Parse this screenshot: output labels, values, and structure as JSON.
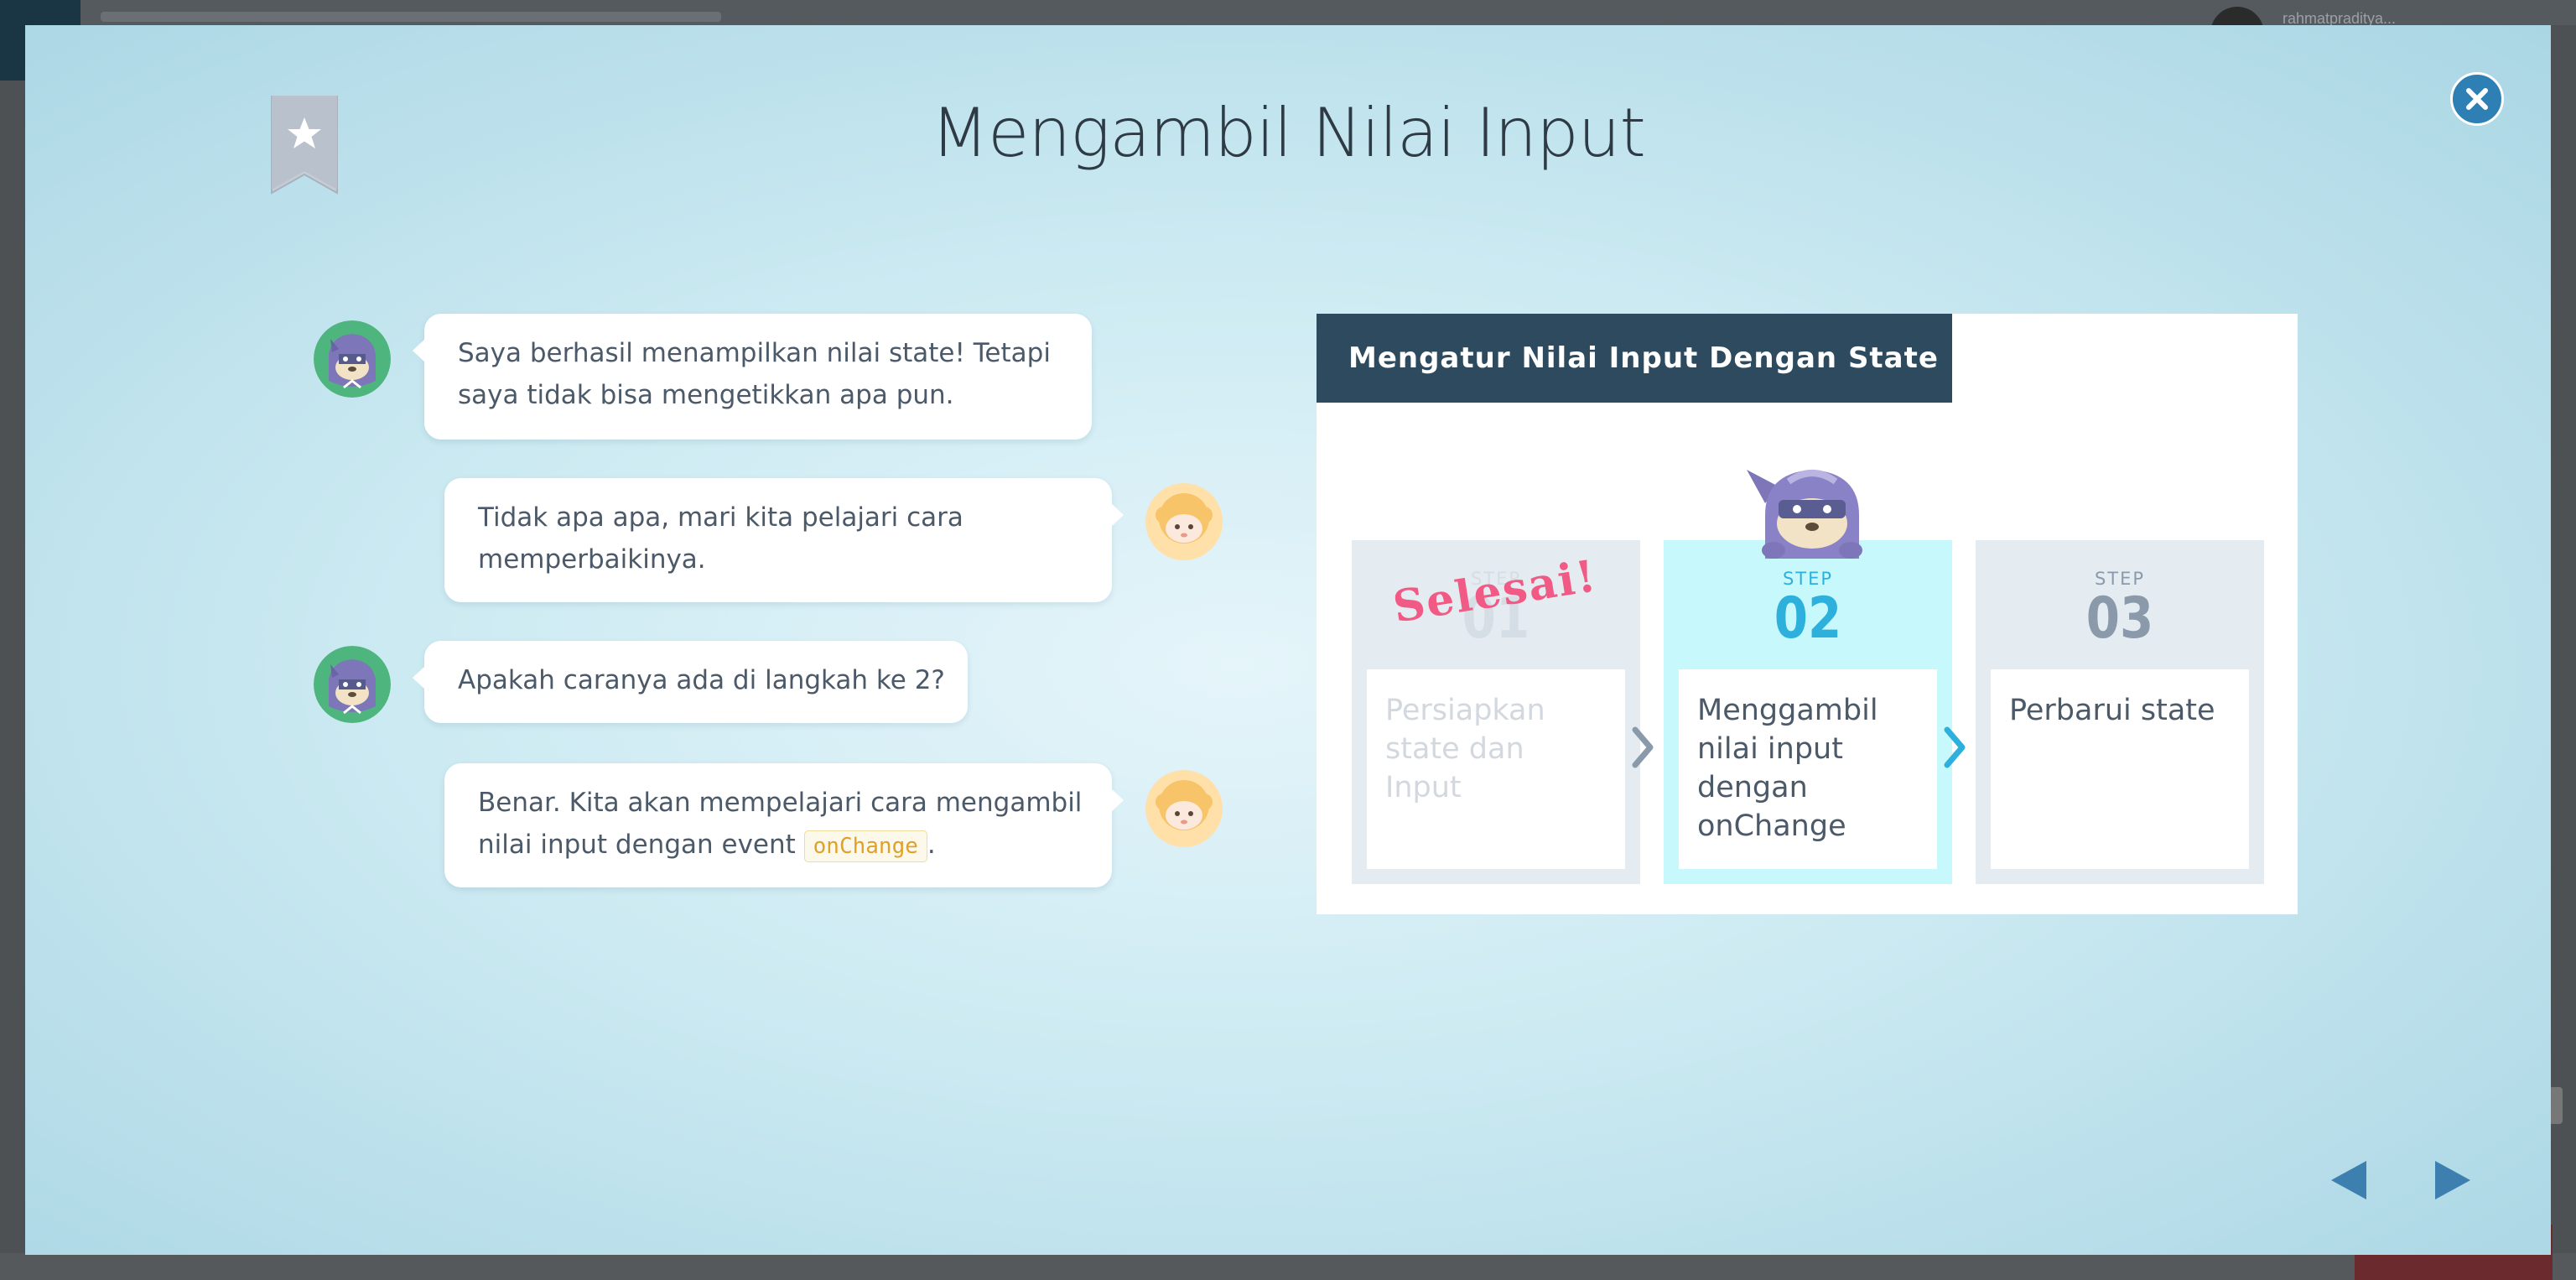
{
  "background": {
    "user_label": "rahmatpraditya..."
  },
  "lesson": {
    "title": "Mengambil Nilai Input"
  },
  "chat": [
    {
      "speaker": "ninja",
      "side": "left",
      "text_1": "Saya berhasil menampilkan nilai state! Tetapi",
      "text_2": "saya tidak bisa mengetikkan apa pun."
    },
    {
      "speaker": "sheep",
      "side": "right",
      "text_1": "Tidak apa apa, mari kita pelajari cara",
      "text_2": "memperbaikinya."
    },
    {
      "speaker": "ninja",
      "side": "left",
      "text_1": "Apakah caranya ada di langkah ke 2?"
    },
    {
      "speaker": "sheep",
      "side": "right",
      "text_1": "Benar. Kita akan mempelajari cara mengambil",
      "text_2a": "nilai input dengan event",
      "code": "onChange",
      "text_2b": "."
    }
  ],
  "slide": {
    "header": "Mengatur Nilai Input Dengan State",
    "completed_stamp": "Selesai!",
    "steps": [
      {
        "label": "STEP",
        "number": "01",
        "text": "Persiapkan state dan Input",
        "status": "done"
      },
      {
        "label": "STEP",
        "number": "02",
        "text": "Menggambil nilai input dengan onChange",
        "status": "current"
      },
      {
        "label": "STEP",
        "number": "03",
        "text": "Perbarui state",
        "status": "upcoming"
      }
    ]
  },
  "colors": {
    "close_button": "#2d7fb4",
    "current_step": "#c7f8fb",
    "header": "#2e4a5f",
    "stamp": "#f25a86",
    "nav_arrow": "#3d80b0"
  },
  "icons": {
    "bookmark": "bookmark-star-icon",
    "close": "close-icon",
    "prev": "triangle-left-icon",
    "next": "triangle-right-icon"
  }
}
